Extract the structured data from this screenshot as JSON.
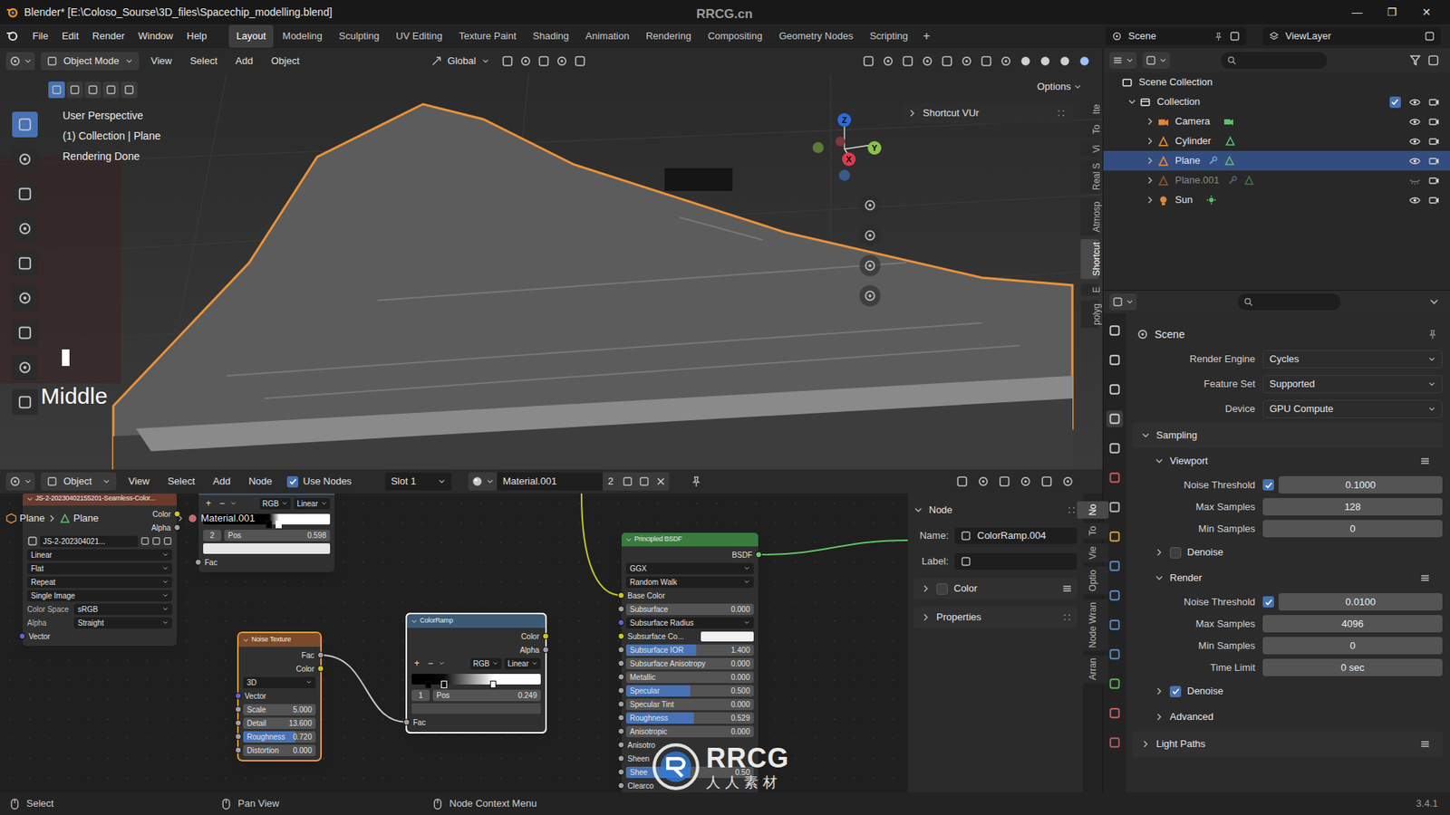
{
  "window": {
    "title": "Blender* [E:\\Coloso_Sourse\\3D_files\\Spacechip_modelling.blend]",
    "watermark": "RRCG.cn",
    "controls": [
      "—",
      "❐",
      "✕"
    ]
  },
  "menubar": {
    "menus": [
      "File",
      "Edit",
      "Render",
      "Window",
      "Help"
    ],
    "workspaces": [
      {
        "label": "Layout",
        "selected": true
      },
      {
        "label": "Modeling",
        "selected": false
      },
      {
        "label": "Sculpting",
        "selected": false
      },
      {
        "label": "UV Editing",
        "selected": false
      },
      {
        "label": "Texture Paint",
        "selected": false
      },
      {
        "label": "Shading",
        "selected": false
      },
      {
        "label": "Animation",
        "selected": false
      },
      {
        "label": "Rendering",
        "selected": false
      },
      {
        "label": "Compositing",
        "selected": false
      },
      {
        "label": "Geometry Nodes",
        "selected": false
      },
      {
        "label": "Scripting",
        "selected": false
      }
    ],
    "add_workspace": "+",
    "scene": "Scene",
    "view_layer": "ViewLayer"
  },
  "viewport": {
    "mode": "Object Mode",
    "menus": [
      "View",
      "Select",
      "Add",
      "Object"
    ],
    "orientation": "Global",
    "options": "Options",
    "info": [
      "User Perspective",
      "(1) Collection | Plane",
      "Rendering Done"
    ],
    "key_overlay": "Middle",
    "side_panel": "Shortcut VUr",
    "axes": {
      "z": "Z",
      "y": "Y",
      "x": "X"
    },
    "tabs": [
      {
        "label": "Ite",
        "selected": false
      },
      {
        "label": "To",
        "selected": false
      },
      {
        "label": "Vi",
        "selected": false
      },
      {
        "label": "Real S",
        "selected": false
      },
      {
        "label": "Atmosp",
        "selected": false
      },
      {
        "label": "Shortcut",
        "selected": true
      },
      {
        "label": "E",
        "selected": false
      },
      {
        "label": "polyg",
        "selected": false
      }
    ]
  },
  "node_editor": {
    "editor_type": "Object",
    "menus": [
      "View",
      "Select",
      "Add",
      "Node"
    ],
    "use_nodes": {
      "label": "Use Nodes",
      "checked": true
    },
    "slot": "Slot 1",
    "material": "Material.001",
    "users": "2",
    "breadcrumb": [
      "Plane",
      "Plane",
      "Material.001"
    ],
    "nodes": [
      {
        "title": "JS-2-20230402155201-Seamless-Color...",
        "color": "#6b3a2c",
        "selected": false,
        "active": false,
        "rows": [
          {
            "kind": "output",
            "label": "Color",
            "socket": "#c7c729"
          },
          {
            "kind": "output",
            "label": "Alpha",
            "socket": "#a1a1a1"
          },
          {
            "kind": "image_selector",
            "label": "JS-2-202304021..."
          },
          {
            "kind": "dropdown",
            "label": "Linear"
          },
          {
            "kind": "dropdown",
            "label": "Flat"
          },
          {
            "kind": "dropdown",
            "label": "Repeat"
          },
          {
            "kind": "dropdown",
            "label": "Single Image"
          },
          {
            "kind": "field",
            "label": "Color Space",
            "value": "sRGB"
          },
          {
            "kind": "field",
            "label": "Alpha",
            "value": "Straight"
          },
          {
            "kind": "input",
            "label": "Vector",
            "socket": "#6363c7"
          }
        ]
      },
      {
        "color": "#3d5a75",
        "selected": false,
        "active": false,
        "rows": [
          {
            "kind": "ramp_controls",
            "buttons": [
              "+",
              "−"
            ],
            "mode": "RGB",
            "interp": "Linear"
          },
          {
            "kind": "ramp",
            "stops": [
              {
                "pos": 0.52,
                "color": "#000000",
                "selected": false
              },
              {
                "pos": 0.598,
                "color": "#ffffff",
                "selected": true
              }
            ]
          },
          {
            "kind": "pos",
            "index": "2",
            "label": "Pos",
            "value": "0.598"
          },
          {
            "kind": "color_bar",
            "color": "#e6e6e6"
          },
          {
            "kind": "input",
            "label": "Fac",
            "socket": "#a1a1a1"
          }
        ]
      },
      {
        "title": "Noise Texture",
        "color": "#7a4a2a",
        "selected": true,
        "active": false,
        "rows": [
          {
            "kind": "output",
            "label": "Fac",
            "socket": "#a1a1a1"
          },
          {
            "kind": "output",
            "label": "Color",
            "socket": "#c7c729"
          },
          {
            "kind": "dropdown",
            "label": "3D"
          },
          {
            "kind": "input",
            "label": "Vector",
            "socket": "#6363c7"
          },
          {
            "kind": "slider",
            "label": "Scale",
            "value": "5.000",
            "level": 0,
            "socket": "#a1a1a1"
          },
          {
            "kind": "slider",
            "label": "Detail",
            "value": "13.600",
            "level": 0,
            "socket": "#a1a1a1"
          },
          {
            "kind": "slider",
            "label": "Roughness",
            "value": "0.720",
            "level": 0.72,
            "socket": "#a1a1a1"
          },
          {
            "kind": "slider",
            "label": "Distortion",
            "value": "0.000",
            "level": 0,
            "socket": "#a1a1a1"
          }
        ]
      },
      {
        "title": "ColorRamp",
        "color": "#3d5a75",
        "selected": true,
        "active": true,
        "rows": [
          {
            "kind": "output",
            "label": "Color",
            "socket": "#c7c729"
          },
          {
            "kind": "output",
            "label": "Alpha",
            "socket": "#a1a1a1"
          },
          {
            "kind": "ramp_controls",
            "buttons": [
              "+",
              "−"
            ],
            "mode": "RGB",
            "interp": "Linear"
          },
          {
            "kind": "ramp",
            "stops": [
              {
                "pos": 0.13,
                "color": "#000000",
                "selected": false
              },
              {
                "pos": 0.25,
                "color": "#0a0a0a",
                "selected": true
              },
              {
                "pos": 0.63,
                "color": "#ffffff",
                "selected": false
              }
            ]
          },
          {
            "kind": "pos",
            "index": "1",
            "label": "Pos",
            "value": "0.249"
          },
          {
            "kind": "color_bar",
            "color": "#4a4a4a"
          },
          {
            "kind": "input",
            "label": "Fac",
            "socket": "#a1a1a1"
          }
        ]
      },
      {
        "title": "Principled BSDF",
        "color": "#3a7a3e",
        "selected": false,
        "active": false,
        "rows": [
          {
            "kind": "output",
            "label": "BSDF",
            "socket": "#63c763"
          },
          {
            "kind": "dropdown",
            "label": "GGX"
          },
          {
            "kind": "dropdown",
            "label": "Random Walk"
          },
          {
            "kind": "input",
            "label": "Base Color",
            "socket": "#c7c729"
          },
          {
            "kind": "slider",
            "label": "Subsurface",
            "value": "0.000",
            "level": 0,
            "socket": "#a1a1a1"
          },
          {
            "kind": "dropdown",
            "label": "Subsurface Radius",
            "socket": "#6363c7"
          },
          {
            "kind": "swatch",
            "label": "Subsurface Co...",
            "color": "#f2f2f2",
            "socket": "#c7c729"
          },
          {
            "kind": "slider",
            "label": "Subsurface IOR",
            "value": "1.400",
            "level": 0.55,
            "socket": "#a1a1a1"
          },
          {
            "kind": "slider",
            "label": "Subsurface Anisotropy",
            "value": "0.000",
            "level": 0,
            "socket": "#a1a1a1"
          },
          {
            "kind": "slider",
            "label": "Metallic",
            "value": "0.000",
            "level": 0,
            "socket": "#a1a1a1"
          },
          {
            "kind": "slider",
            "label": "Specular",
            "value": "0.500",
            "level": 0.5,
            "socket": "#a1a1a1"
          },
          {
            "kind": "slider",
            "label": "Specular Tint",
            "value": "0.000",
            "level": 0,
            "socket": "#a1a1a1"
          },
          {
            "kind": "slider",
            "label": "Roughness",
            "value": "0.529",
            "level": 0.53,
            "socket": "#a1a1a1"
          },
          {
            "kind": "slider",
            "label": "Anisotropic",
            "value": "0.000",
            "level": 0,
            "socket": "#a1a1a1"
          },
          {
            "kind": "input",
            "label": "Anisotro",
            "socket": "#a1a1a1"
          },
          {
            "kind": "input",
            "label": "Sheen",
            "socket": "#a1a1a1"
          },
          {
            "kind": "slider",
            "label": "Shee",
            "value": "0.50",
            "level": 0.5,
            "socket": "#a1a1a1"
          },
          {
            "kind": "input",
            "label": "Clearco",
            "socket": "#a1a1a1"
          }
        ]
      }
    ],
    "sidebar": {
      "section": {
        "label": "Node",
        "expanded": true
      },
      "name_label": "Name:",
      "name": "ColorRamp.004",
      "label_label": "Label:",
      "panels": [
        {
          "kind": "check_panel",
          "label": "Color",
          "expanded": false,
          "checked": false
        },
        {
          "kind": "panel",
          "label": "Properties",
          "expanded": false
        }
      ]
    },
    "tabs": [
      {
        "label": "No",
        "selected": true
      },
      {
        "label": "To",
        "selected": false
      },
      {
        "label": "Vie",
        "selected": false
      },
      {
        "label": "Optio",
        "selected": false
      },
      {
        "label": "Node Wran",
        "selected": false
      },
      {
        "label": "Arran",
        "selected": false
      }
    ]
  },
  "outliner": {
    "items": [
      {
        "label": "Scene Collection",
        "depth": 0,
        "kind": "scene_collection",
        "selected": false
      },
      {
        "label": "Collection",
        "depth": 1,
        "kind": "collection",
        "expanded": true,
        "selected": false,
        "visible": true,
        "checked": true
      },
      {
        "label": "Camera",
        "depth": 2,
        "kind": "camera",
        "expanded": false,
        "selected": false,
        "visible": true,
        "modifier": false
      },
      {
        "label": "Cylinder",
        "depth": 2,
        "kind": "mesh",
        "expanded": false,
        "selected": false,
        "visible": true,
        "modifier": false
      },
      {
        "label": "Plane",
        "depth": 2,
        "kind": "mesh",
        "expanded": false,
        "selected": true,
        "visible": true,
        "modifier": true
      },
      {
        "label": "Plane.001",
        "depth": 2,
        "kind": "mesh",
        "expanded": false,
        "selected": false,
        "visible": false,
        "modifier": true
      },
      {
        "label": "Sun",
        "depth": 2,
        "kind": "light",
        "expanded": false,
        "selected": false,
        "visible": true,
        "modifier": false
      }
    ]
  },
  "properties": {
    "rows": [
      {
        "kind": "title",
        "label": "Scene"
      },
      {
        "kind": "dropdown",
        "label": "Render Engine",
        "value": "Cycles"
      },
      {
        "kind": "dropdown",
        "label": "Feature Set",
        "value": "Supported"
      },
      {
        "kind": "dropdown",
        "label": "Device",
        "value": "GPU Compute"
      },
      {
        "kind": "panel",
        "label": "Sampling",
        "expanded": true,
        "depth": 0,
        "presets": false
      },
      {
        "kind": "panel",
        "label": "Viewport",
        "expanded": true,
        "depth": 1,
        "presets": true
      },
      {
        "kind": "check_number",
        "label": "Noise Threshold",
        "value": "0.1000",
        "checked": true
      },
      {
        "kind": "number",
        "label": "Max Samples",
        "value": "128"
      },
      {
        "kind": "number",
        "label": "Min Samples",
        "value": "0"
      },
      {
        "kind": "check_panel",
        "label": "Denoise",
        "expanded": false,
        "checked": false,
        "depth": 1
      },
      {
        "kind": "panel",
        "label": "Render",
        "expanded": true,
        "depth": 1,
        "presets": true
      },
      {
        "kind": "check_number",
        "label": "Noise Threshold",
        "value": "0.0100",
        "checked": true
      },
      {
        "kind": "number",
        "label": "Max Samples",
        "value": "4096"
      },
      {
        "kind": "number",
        "label": "Min Samples",
        "value": "0"
      },
      {
        "kind": "number",
        "label": "Time Limit",
        "value": "0 sec"
      },
      {
        "kind": "check_panel",
        "label": "Denoise",
        "expanded": false,
        "checked": true,
        "depth": 1
      },
      {
        "kind": "panel",
        "label": "Advanced",
        "expanded": false,
        "depth": 1,
        "presets": false
      },
      {
        "kind": "panel",
        "label": "Light Paths",
        "expanded": false,
        "depth": 0,
        "presets": true
      }
    ]
  },
  "status_bar": {
    "items": [
      "Select",
      "Pan View",
      "Node Context Menu"
    ],
    "version": "3.4.1"
  },
  "watermark": {
    "logo": "RRCG",
    "text": "人人素材"
  }
}
